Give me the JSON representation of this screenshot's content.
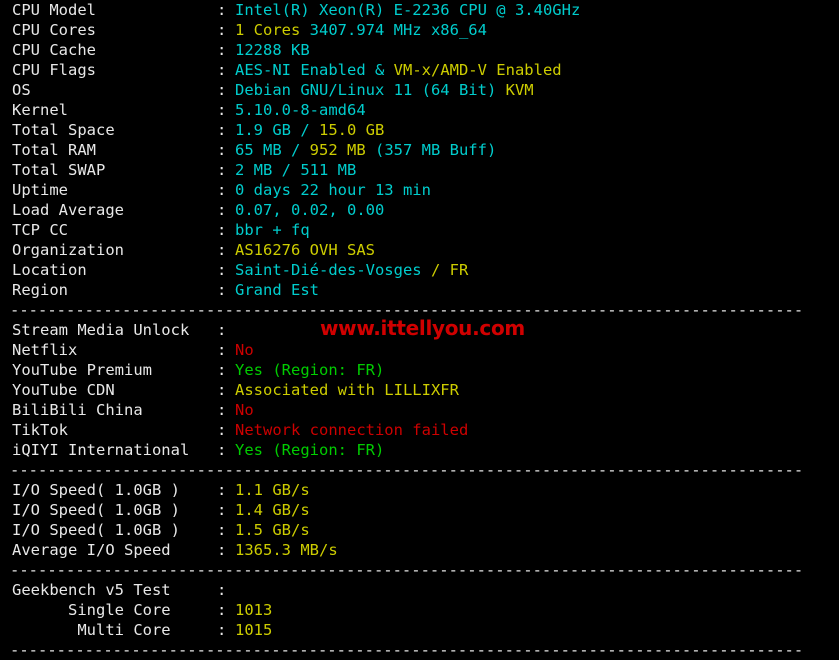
{
  "terminal": {
    "background_color": "#000000",
    "colors": {
      "label": "#e8e8e8",
      "cyan": "#00cdcd",
      "yellow": "#cdcd00",
      "green": "#00cd00",
      "red": "#cd0000",
      "watermark": "#d00000"
    },
    "separator_text": "-------------------------------------------------------------------------------------"
  },
  "watermark": {
    "text": "www.ittellyou.com"
  },
  "colon": ":",
  "system_info": [
    {
      "label": "CPU Model",
      "parts": [
        {
          "text": "Intel(R) Xeon(R) E-2236 CPU @ 3.40GHz",
          "color": "cyan"
        }
      ]
    },
    {
      "label": "CPU Cores",
      "parts": [
        {
          "text": "1 Cores",
          "color": "yellow"
        },
        {
          "text": " 3407.974 MHz x86_64",
          "color": "cyan"
        }
      ]
    },
    {
      "label": "CPU Cache",
      "parts": [
        {
          "text": "12288 KB",
          "color": "cyan"
        }
      ]
    },
    {
      "label": "CPU Flags",
      "parts": [
        {
          "text": "AES-NI Enabled",
          "color": "cyan"
        },
        {
          "text": " & ",
          "color": "cyan"
        },
        {
          "text": "VM-x/AMD-V Enabled",
          "color": "yellow"
        }
      ]
    },
    {
      "label": "OS",
      "parts": [
        {
          "text": "Debian GNU/Linux 11 (64 Bit) ",
          "color": "cyan"
        },
        {
          "text": "KVM",
          "color": "yellow"
        }
      ]
    },
    {
      "label": "Kernel",
      "parts": [
        {
          "text": "5.10.0-8-amd64",
          "color": "cyan"
        }
      ]
    },
    {
      "label": "Total Space",
      "parts": [
        {
          "text": "1.9 GB / ",
          "color": "cyan"
        },
        {
          "text": "15.0 GB",
          "color": "yellow"
        }
      ]
    },
    {
      "label": "Total RAM",
      "parts": [
        {
          "text": "65 MB / ",
          "color": "cyan"
        },
        {
          "text": "952 MB",
          "color": "yellow"
        },
        {
          "text": " (357 MB Buff)",
          "color": "cyan"
        }
      ]
    },
    {
      "label": "Total SWAP",
      "parts": [
        {
          "text": "2 MB / 511 MB",
          "color": "cyan"
        }
      ]
    },
    {
      "label": "Uptime",
      "parts": [
        {
          "text": "0 days 22 hour 13 min",
          "color": "cyan"
        }
      ]
    },
    {
      "label": "Load Average",
      "parts": [
        {
          "text": "0.07, 0.02, 0.00",
          "color": "cyan"
        }
      ]
    },
    {
      "label": "TCP CC",
      "parts": [
        {
          "text": "bbr + fq",
          "color": "cyan"
        }
      ]
    },
    {
      "label": "Organization",
      "parts": [
        {
          "text": "AS16276 OVH SAS",
          "color": "yellow"
        }
      ]
    },
    {
      "label": "Location",
      "parts": [
        {
          "text": "Saint-Dié-des-Vosges ",
          "color": "cyan"
        },
        {
          "text": "/ FR",
          "color": "yellow"
        }
      ]
    },
    {
      "label": "Region",
      "parts": [
        {
          "text": "Grand Est",
          "color": "cyan"
        }
      ]
    }
  ],
  "stream_media": [
    {
      "label": "Stream Media Unlock",
      "parts": []
    },
    {
      "label": "Netflix",
      "parts": [
        {
          "text": "No",
          "color": "red"
        }
      ]
    },
    {
      "label": "YouTube Premium",
      "parts": [
        {
          "text": "Yes (Region: FR)",
          "color": "green"
        }
      ]
    },
    {
      "label": "YouTube CDN",
      "parts": [
        {
          "text": "Associated with LILLIXFR",
          "color": "yellow"
        }
      ]
    },
    {
      "label": "BiliBili China",
      "parts": [
        {
          "text": "No",
          "color": "red"
        }
      ]
    },
    {
      "label": "TikTok",
      "parts": [
        {
          "text": "Network connection failed",
          "color": "red"
        }
      ]
    },
    {
      "label": "iQIYI International",
      "parts": [
        {
          "text": "Yes (Region: FR)",
          "color": "green"
        }
      ]
    }
  ],
  "io_speed": [
    {
      "label": "I/O Speed( 1.0GB )",
      "parts": [
        {
          "text": "1.1 GB/s",
          "color": "yellow"
        }
      ]
    },
    {
      "label": "I/O Speed( 1.0GB )",
      "parts": [
        {
          "text": "1.4 GB/s",
          "color": "yellow"
        }
      ]
    },
    {
      "label": "I/O Speed( 1.0GB )",
      "parts": [
        {
          "text": "1.5 GB/s",
          "color": "yellow"
        }
      ]
    },
    {
      "label": "Average I/O Speed",
      "parts": [
        {
          "text": "1365.3 MB/s",
          "color": "yellow"
        }
      ]
    }
  ],
  "geekbench": [
    {
      "label": "Geekbench v5 Test",
      "parts": []
    },
    {
      "label": "      Single Core",
      "parts": [
        {
          "text": "1013",
          "color": "yellow"
        }
      ]
    },
    {
      "label": "       Multi Core",
      "parts": [
        {
          "text": "1015",
          "color": "yellow"
        }
      ]
    }
  ]
}
